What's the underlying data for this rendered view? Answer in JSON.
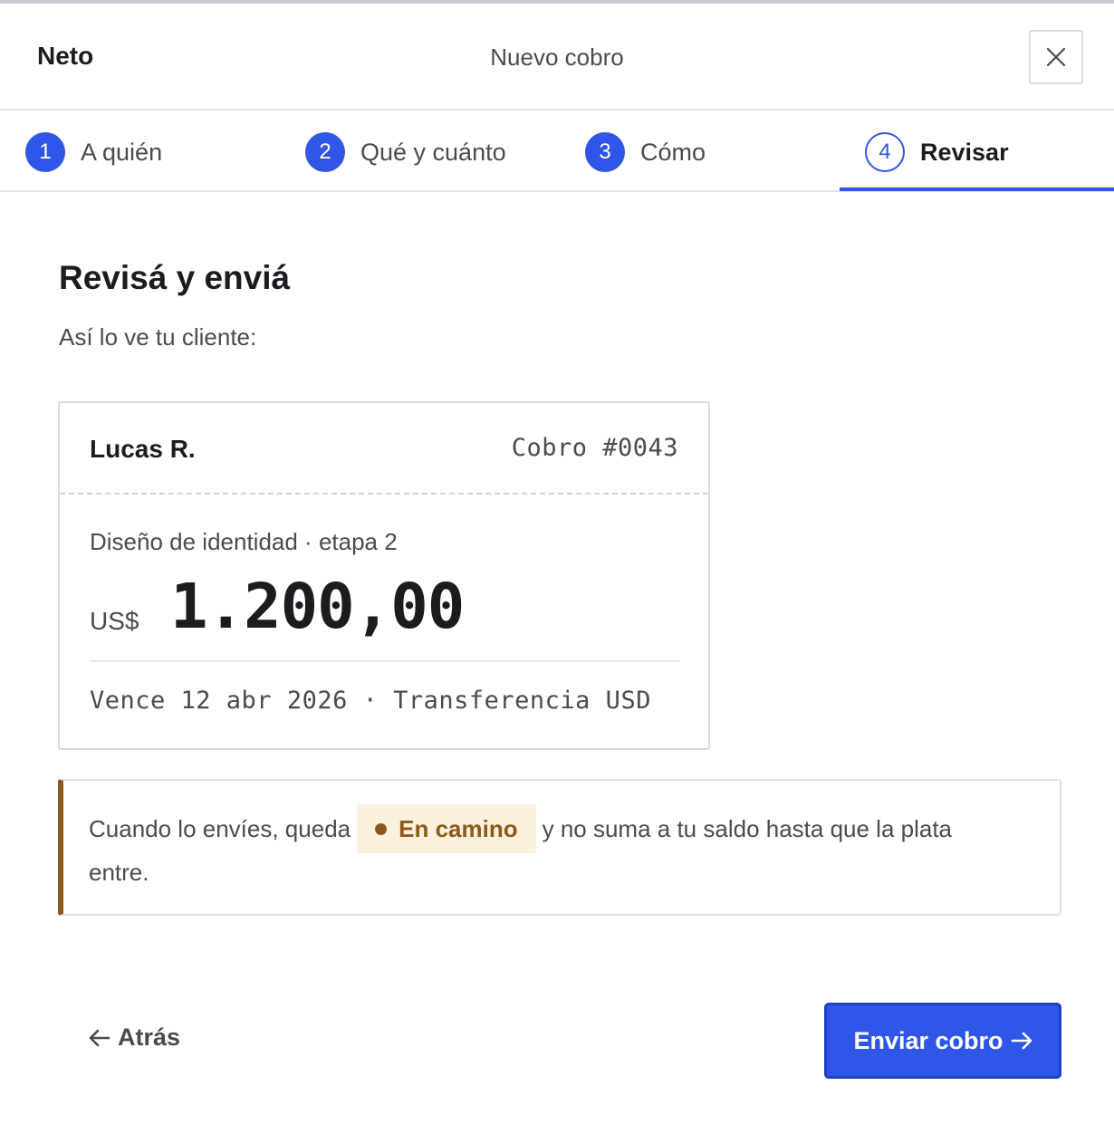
{
  "app": {
    "brand": "Neto",
    "title": "Nuevo cobro"
  },
  "steps": [
    {
      "number": "1",
      "label": "A quién"
    },
    {
      "number": "2",
      "label": "Qué y cuánto"
    },
    {
      "number": "3",
      "label": "Cómo"
    },
    {
      "number": "4",
      "label": "Revisar"
    }
  ],
  "colors": {
    "accent": "#2f56e8",
    "warning": "#8a5a1a",
    "warning_bg": "#fbf0dc"
  },
  "review": {
    "title": "Revisá y enviá",
    "subtitle": "Así lo ve tu cliente:"
  },
  "invoice": {
    "client": "Lucas R.",
    "id": "Cobro #0043",
    "description": "Diseño de identidad · etapa 2",
    "currency": "US$",
    "amount": "1.200,00",
    "meta": "Vence 12 abr 2026 · Transferencia USD"
  },
  "notice": {
    "text_before": "Cuando lo envíes, queda",
    "badge": "En camino",
    "text_after": "y no suma a tu saldo hasta que la plata",
    "text_wrap": "entre."
  },
  "actions": {
    "back_label": "Atrás",
    "send_label": "Enviar cobro"
  },
  "icons": {
    "close": "close-icon",
    "back": "arrow-left-icon",
    "send": "arrow-right-icon"
  }
}
